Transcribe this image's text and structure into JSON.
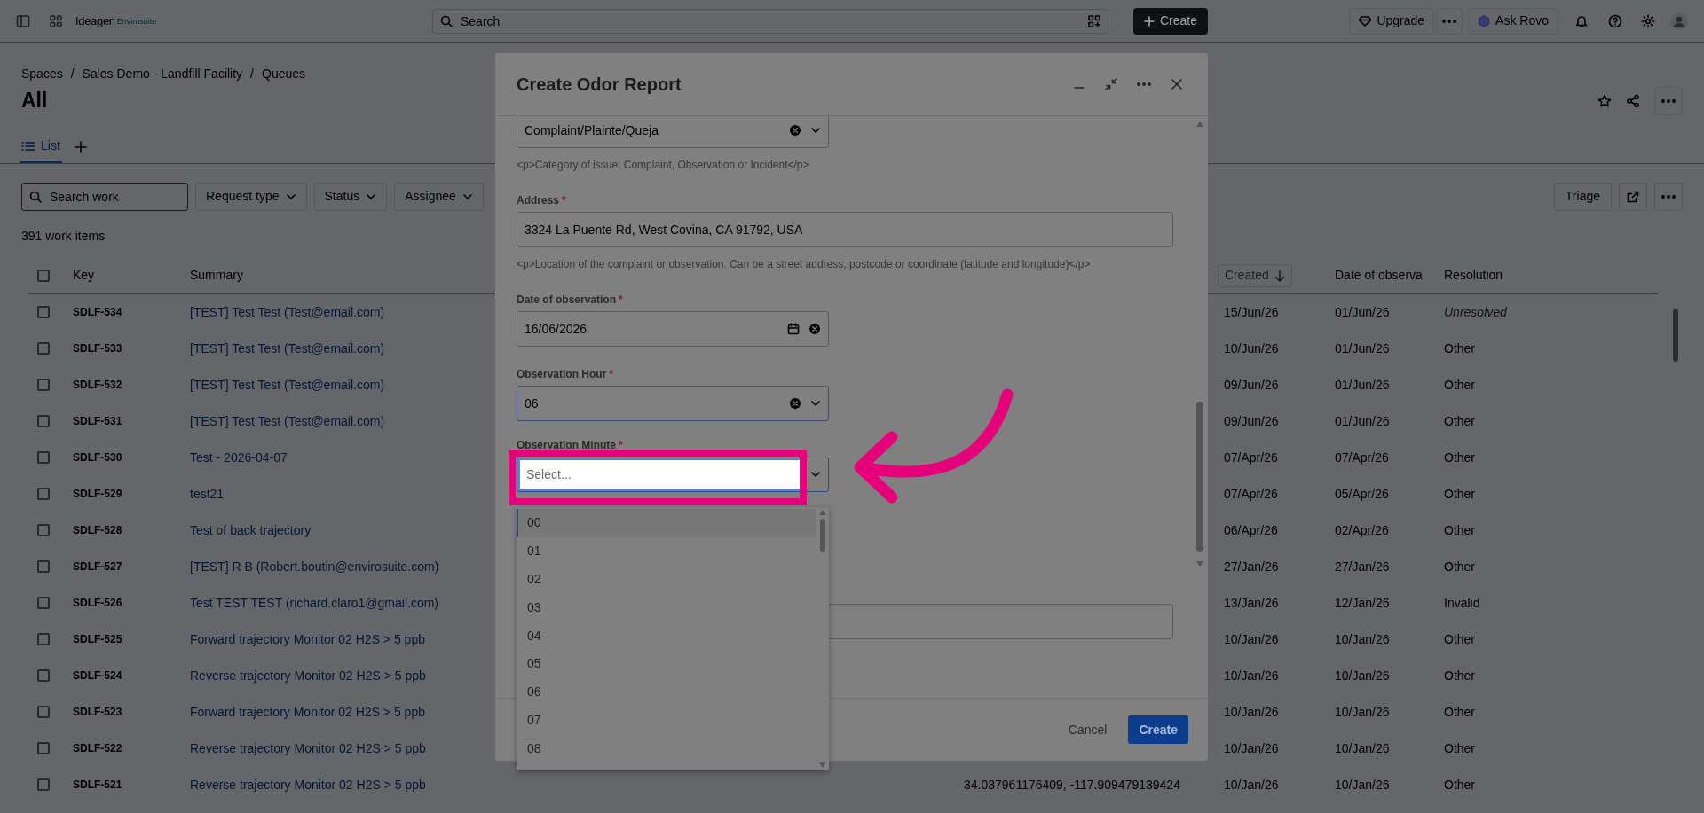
{
  "top_bar": {
    "logo": "Ideagen",
    "logo_sub": "Envirosuite",
    "search": {
      "placeholder": "Search"
    },
    "create_button": "Create",
    "upgrade_button": "Upgrade",
    "ask_button": "Ask Rovo"
  },
  "breadcrumbs": [
    "Spaces",
    "Sales Demo - Landfill Facility",
    "Queues"
  ],
  "breadcrumb_separator": "/",
  "page_title": "All",
  "view_tabs": [
    {
      "label": "List",
      "selected": true
    }
  ],
  "filters": {
    "search": {
      "placeholder": "Search work"
    },
    "buttons": [
      "Request type",
      "Status",
      "Assignee"
    ]
  },
  "triage_button": "Triage",
  "count": "391 work items",
  "table": {
    "header_checkbox": {
      "checked": false
    },
    "columns": [
      {
        "label": "Key",
        "sorted": false
      },
      {
        "label": "Summary",
        "sorted": false
      },
      {
        "label": "Created",
        "sorted": true
      },
      {
        "label": "Date of observa",
        "sorted": false
      },
      {
        "label": "Resolution",
        "sorted": false
      }
    ],
    "rows": [
      {
        "checked": false,
        "key": "SDLF-534",
        "summary": "[TEST] Test Test (Test@email.com)",
        "created": "15/Jun/26",
        "date_of_observation": "01/Jun/26",
        "resolution": "Unresolved",
        "resolved": false
      },
      {
        "checked": false,
        "key": "SDLF-533",
        "summary": "[TEST] Test Test (Test@email.com)",
        "created": "10/Jun/26",
        "date_of_observation": "01/Jun/26",
        "resolution": "Other",
        "resolved": true
      },
      {
        "checked": false,
        "key": "SDLF-532",
        "summary": "[TEST] Test Test (Test@email.com)",
        "created": "09/Jun/26",
        "date_of_observation": "01/Jun/26",
        "resolution": "Other",
        "resolved": true
      },
      {
        "checked": false,
        "key": "SDLF-531",
        "summary": "[TEST] Test Test (Test@email.com)",
        "created": "09/Jun/26",
        "date_of_observation": "01/Jun/26",
        "resolution": "Other",
        "resolved": true
      },
      {
        "checked": false,
        "key": "SDLF-530",
        "summary": "Test - 2026-04-07",
        "created": "07/Apr/26",
        "date_of_observation": "07/Apr/26",
        "resolution": "Other",
        "resolved": true
      },
      {
        "checked": false,
        "key": "SDLF-529",
        "summary": "test21",
        "created": "07/Apr/26",
        "date_of_observation": "05/Apr/26",
        "resolution": "Other",
        "resolved": true
      },
      {
        "checked": false,
        "key": "SDLF-528",
        "summary": "Test of back trajectory",
        "created": "06/Apr/26",
        "date_of_observation": "02/Apr/26",
        "resolution": "Other",
        "resolved": true
      },
      {
        "checked": false,
        "key": "SDLF-527",
        "summary": "[TEST] R B (Robert.boutin@envirosuite.com)",
        "created": "27/Jan/26",
        "date_of_observation": "27/Jan/26",
        "resolution": "Other",
        "resolved": true
      },
      {
        "checked": false,
        "key": "SDLF-526",
        "summary": "Test TEST TEST (richard.claro1@gmail.com)",
        "created": "13/Jan/26",
        "date_of_observation": "12/Jan/26",
        "resolution": "Invalid",
        "resolved": true
      },
      {
        "checked": false,
        "key": "SDLF-525",
        "summary": "Forward trajectory Monitor 02 H2S > 5 ppb",
        "created": "10/Jan/26",
        "date_of_observation": "10/Jan/26",
        "resolution": "Other",
        "resolved": true
      },
      {
        "checked": false,
        "key": "SDLF-524",
        "summary": "Reverse trajectory Monitor 02 H2S > 5 ppb",
        "created": "10/Jan/26",
        "date_of_observation": "10/Jan/26",
        "resolution": "Other",
        "resolved": true
      },
      {
        "checked": false,
        "key": "SDLF-523",
        "summary": "Forward trajectory Monitor 02 H2S > 5 ppb",
        "created": "10/Jan/26",
        "date_of_observation": "10/Jan/26",
        "resolution": "Other",
        "resolved": true
      },
      {
        "checked": false,
        "key": "SDLF-522",
        "summary": "Reverse trajectory Monitor 02 H2S > 5 ppb",
        "created": "10/Jan/26",
        "date_of_observation": "10/Jan/26",
        "resolution": "Other",
        "resolved": true
      },
      {
        "checked": false,
        "key": "SDLF-521",
        "summary": "Reverse trajectory Monitor 02 H2S > 5 ppb",
        "column_3": "34.037961176409, -117.909479139424",
        "created": "10/Jan/26",
        "date_of_observation": "10/Jan/26",
        "resolution": "Other",
        "resolved": true
      }
    ]
  },
  "modal": {
    "title": "Create Odor Report",
    "fields": [
      {
        "kind": "select",
        "value": "Complaint/Plainte/Queja",
        "help": "<p>Category of issue: Complaint, Observation or Incident</p>"
      },
      {
        "kind": "text",
        "label": "Address",
        "required_mark": "*",
        "value": "3324 La Puente Rd, West Covina, CA 91792, USA",
        "help": "<p>Location of the complaint or observation. Can be a street address, postcode or coordinate (latitude and longitude)</p>"
      },
      {
        "kind": "date",
        "label": "Date of observation",
        "required_mark": "*",
        "value": "16/06/2026"
      },
      {
        "kind": "select",
        "label": "Observation Hour",
        "required_mark": "*",
        "value": "06"
      },
      {
        "kind": "combo",
        "label": "Observation Minute",
        "required_mark": "*",
        "placeholder": "Select...",
        "options": [
          {
            "label": "00",
            "selected": true
          },
          {
            "label": "01",
            "selected": false
          },
          {
            "label": "02",
            "selected": false
          },
          {
            "label": "03",
            "selected": false
          },
          {
            "label": "04",
            "selected": false
          },
          {
            "label": "05",
            "selected": false
          },
          {
            "label": "06",
            "selected": false
          },
          {
            "label": "07",
            "selected": false
          },
          {
            "label": "08",
            "selected": false
          }
        ]
      },
      {
        "kind": "text"
      }
    ],
    "cancel_button": "Cancel",
    "create_button": "Create"
  }
}
